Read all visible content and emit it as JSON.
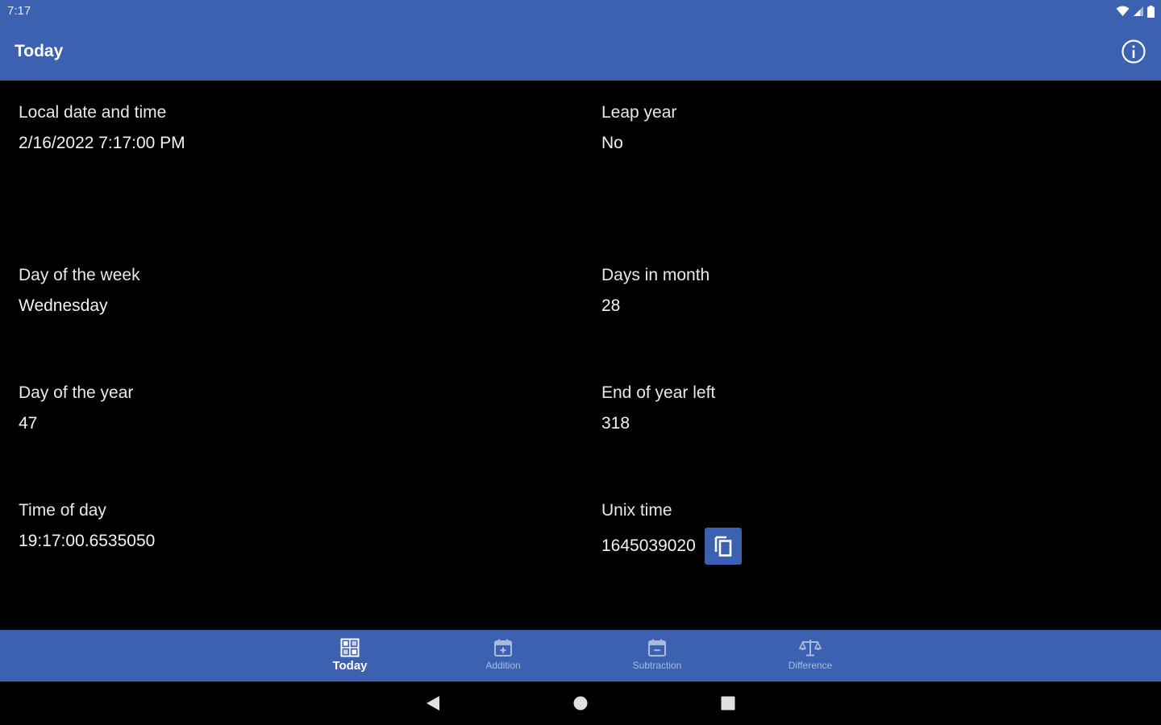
{
  "status_bar": {
    "time": "7:17",
    "icons": [
      "wifi-icon",
      "signal-icon",
      "battery-icon"
    ]
  },
  "app_bar": {
    "title": "Today",
    "info_icon": "info-icon"
  },
  "fields": {
    "local_datetime": {
      "label": "Local date and time",
      "value": "2/16/2022 7:17:00 PM"
    },
    "leap_year": {
      "label": "Leap year",
      "value": "No"
    },
    "day_of_week": {
      "label": "Day of the week",
      "value": "Wednesday"
    },
    "days_in_month": {
      "label": "Days in month",
      "value": "28"
    },
    "day_of_year": {
      "label": "Day of the year",
      "value": "47"
    },
    "end_of_year_left": {
      "label": "End of year left",
      "value": "318"
    },
    "time_of_day": {
      "label": "Time of day",
      "value": "19:17:00.6535050"
    },
    "unix_time": {
      "label": "Unix time",
      "value": "1645039020",
      "action_icon": "copy-icon"
    }
  },
  "bottom_nav": {
    "tabs": [
      {
        "label": "Today",
        "icon": "today-grid-icon",
        "active": true
      },
      {
        "label": "Addition",
        "icon": "calendar-add-icon",
        "active": false
      },
      {
        "label": "Subtraction",
        "icon": "calendar-subtract-icon",
        "active": false
      },
      {
        "label": "Difference",
        "icon": "scale-icon",
        "active": false
      }
    ]
  },
  "system_nav": {
    "buttons": [
      "back-icon",
      "home-icon",
      "recents-icon"
    ]
  },
  "colors": {
    "primary": "#3b61b0",
    "background": "#000000",
    "text": "#ffffff",
    "inactive_tab": "#a9bbe0"
  }
}
